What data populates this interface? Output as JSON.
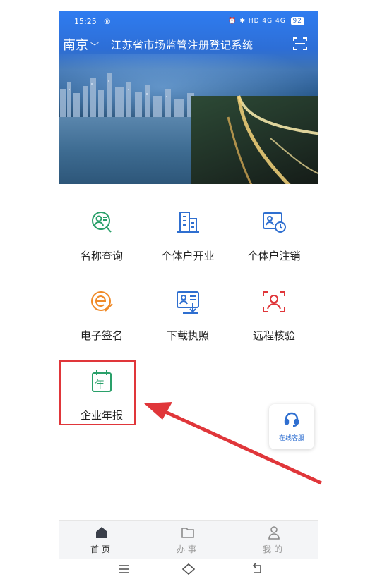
{
  "status_bar": {
    "time": "15:25",
    "record_icon": "®",
    "icons_text": "⏰ ✱ HD 4G 4G",
    "battery": "92"
  },
  "header": {
    "city": "南京",
    "title": "江苏省市场监管注册登记系统"
  },
  "services": [
    {
      "label": "名称查询",
      "icon": "name-search-icon",
      "color": "#2aa06a"
    },
    {
      "label": "个体户开业",
      "icon": "building-icon",
      "color": "#2f6fd0"
    },
    {
      "label": "个体户注销",
      "icon": "id-card-clock-icon",
      "color": "#2f6fd0"
    },
    {
      "label": "电子签名",
      "icon": "e-signature-icon",
      "color": "#f08a28"
    },
    {
      "label": "下载执照",
      "icon": "license-download-icon",
      "color": "#2f6fd0"
    },
    {
      "label": "远程核验",
      "icon": "face-verify-icon",
      "color": "#e0363a"
    },
    {
      "label": "企业年报",
      "icon": "calendar-year-icon",
      "color": "#2aa06a",
      "icon_char": "年"
    }
  ],
  "customer_service": {
    "label": "在线客服",
    "icon": "headset-icon"
  },
  "bottom_nav": [
    {
      "label": "首页",
      "icon": "home-icon",
      "active": true
    },
    {
      "label": "办事",
      "icon": "folder-icon",
      "active": false
    },
    {
      "label": "我的",
      "icon": "user-icon",
      "active": false
    }
  ],
  "colors": {
    "accent": "#2f6fd0",
    "annotation_red": "#e0363a"
  }
}
